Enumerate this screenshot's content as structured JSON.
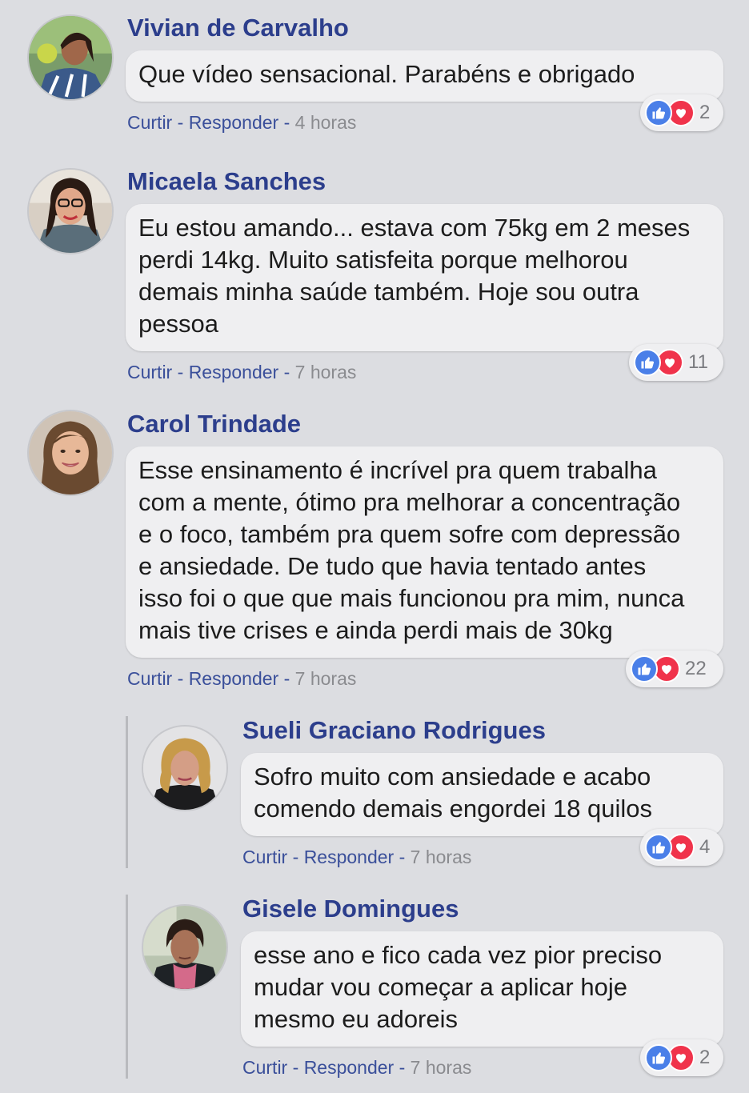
{
  "comments": [
    {
      "author": "Vivian de Carvalho",
      "text": "Que vídeo sensacional. Parabéns e obrigado",
      "like_label": "Curtir",
      "reply_label": "Responder",
      "sep": " - ",
      "time": "4 horas",
      "reaction_count": "2",
      "reaction_icons": [
        "like-icon",
        "heart-icon"
      ]
    },
    {
      "author": "Micaela Sanches",
      "text": "Eu estou amando... estava com 75kg em 2 meses\nperdi 14kg. Muito satisfeita porque melhorou\ndemais minha saúde também. Hoje sou outra\npessoa",
      "like_label": "Curtir",
      "reply_label": "Responder",
      "sep": " - ",
      "time": "7 horas",
      "reaction_count": "11",
      "reaction_icons": [
        "like-icon",
        "heart-icon"
      ]
    },
    {
      "author": "Carol Trindade",
      "text": "Esse ensinamento é incrível pra quem trabalha\ncom a mente, ótimo pra melhorar a concentração\ne o foco, também pra quem sofre com depressão\ne ansiedade. De tudo que havia tentado antes\nisso foi o que que mais funcionou pra mim, nunca\nmais tive crises e ainda perdi mais de 30kg",
      "like_label": "Curtir",
      "reply_label": "Responder",
      "sep": " - ",
      "time": "7 horas",
      "reaction_count": "22",
      "reaction_icons": [
        "like-icon",
        "heart-icon"
      ]
    }
  ],
  "replies": [
    {
      "author": "Sueli Graciano Rodrigues",
      "text": "Sofro muito com ansiedade e acabo\ncomendo demais engordei 18 quilos",
      "like_label": "Curtir",
      "reply_label": "Responder",
      "sep": " - ",
      "time": "7 horas",
      "reaction_count": "4",
      "reaction_icons": [
        "like-icon",
        "heart-icon"
      ]
    },
    {
      "author": "Gisele Domingues",
      "text": "esse ano e fico cada vez pior preciso\nmudar vou começar a aplicar hoje\nmesmo eu adoreis",
      "like_label": "Curtir",
      "reply_label": "Responder",
      "sep": " - ",
      "time": "7 horas",
      "reaction_count": "2",
      "reaction_icons": [
        "like-icon",
        "heart-icon"
      ]
    }
  ],
  "colors": {
    "background": "#dcdde1",
    "author": "#2c3e8c",
    "link": "#3a4f9a",
    "time": "#8a8b8f",
    "like": "#4a7fe8",
    "love": "#f0334b"
  }
}
